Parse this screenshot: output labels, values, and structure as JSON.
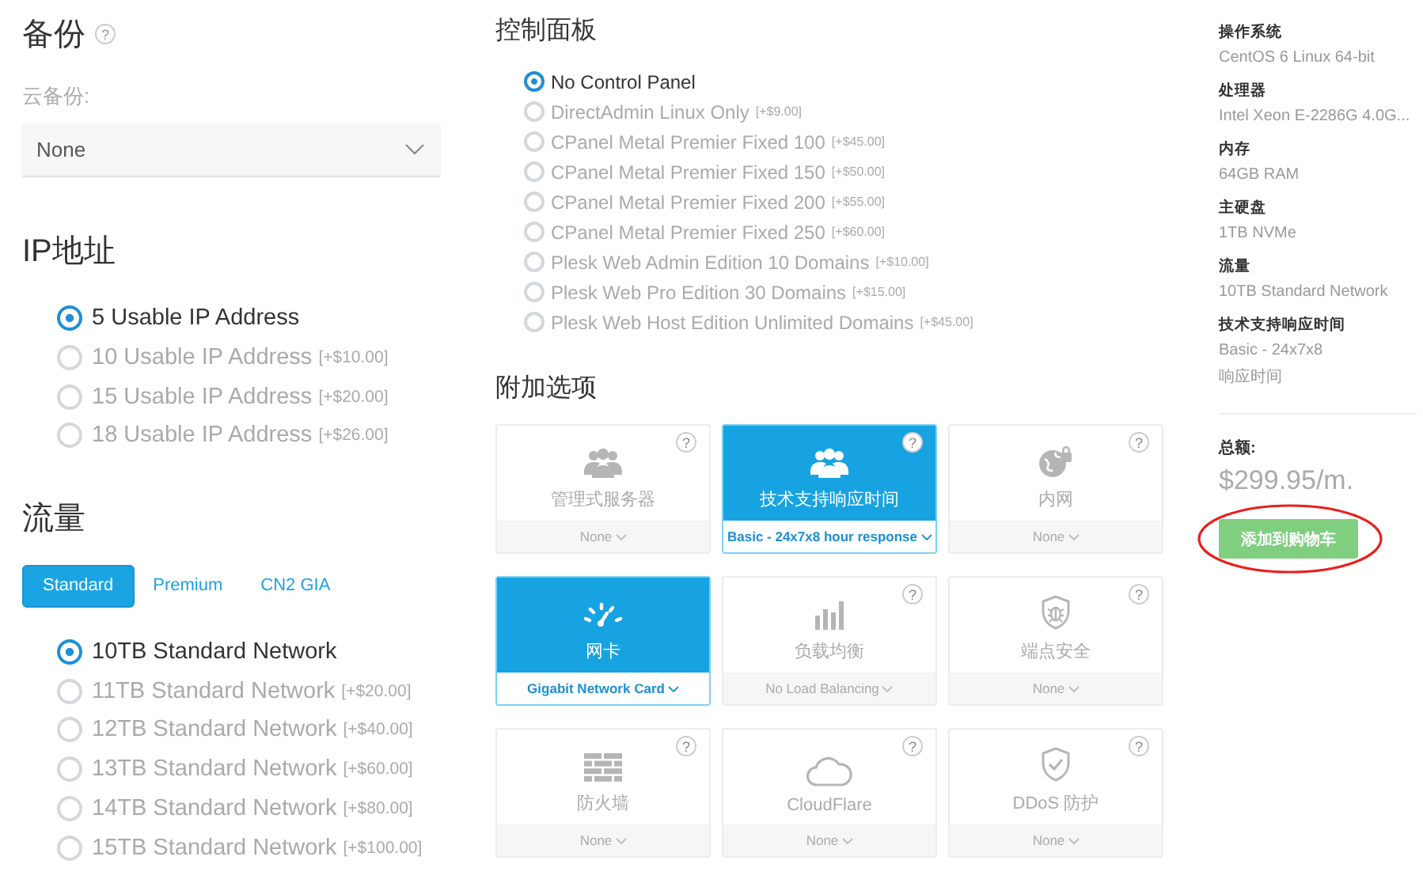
{
  "backup": {
    "title": "备份",
    "help": "?",
    "field_label": "云备份:",
    "select": {
      "value": "None"
    }
  },
  "ip": {
    "title": "IP地址",
    "options": [
      {
        "label": "5 Usable IP Address",
        "selected": true
      },
      {
        "label": "10 Usable IP Address",
        "price": "[+$10.00]",
        "selected": false
      },
      {
        "label": "15 Usable IP Address",
        "price": "[+$20.00]",
        "selected": false
      },
      {
        "label": "18 Usable IP Address",
        "price": "[+$26.00]",
        "selected": false
      }
    ]
  },
  "traffic": {
    "title": "流量",
    "tabs": [
      {
        "label": "Standard",
        "selected": true
      },
      {
        "label": "Premium",
        "selected": false
      },
      {
        "label": "CN2 GIA",
        "selected": false
      }
    ],
    "options": [
      {
        "label": "10TB Standard Network",
        "selected": true
      },
      {
        "label": "11TB Standard Network",
        "price": "[+$20.00]",
        "selected": false
      },
      {
        "label": "12TB Standard Network",
        "price": "[+$40.00]",
        "selected": false
      },
      {
        "label": "13TB Standard Network",
        "price": "[+$60.00]",
        "selected": false
      },
      {
        "label": "14TB Standard Network",
        "price": "[+$80.00]",
        "selected": false
      },
      {
        "label": "15TB Standard Network",
        "price": "[+$100.00]",
        "selected": false
      }
    ]
  },
  "control_panel": {
    "title": "控制面板",
    "options": [
      {
        "label": "No Control Panel",
        "selected": true
      },
      {
        "label": "DirectAdmin Linux Only",
        "price": "[+$9.00]",
        "selected": false
      },
      {
        "label": "CPanel Metal Premier Fixed 100",
        "price": "[+$45.00]",
        "selected": false
      },
      {
        "label": "CPanel Metal Premier Fixed 150",
        "price": "[+$50.00]",
        "selected": false
      },
      {
        "label": "CPanel Metal Premier Fixed 200",
        "price": "[+$55.00]",
        "selected": false
      },
      {
        "label": "CPanel Metal Premier Fixed 250",
        "price": "[+$60.00]",
        "selected": false
      },
      {
        "label": "Plesk Web Admin Edition 10 Domains",
        "price": "[+$10.00]",
        "selected": false
      },
      {
        "label": "Plesk Web Pro Edition 30 Domains",
        "price": "[+$15.00]",
        "selected": false
      },
      {
        "label": "Plesk Web Host Edition Unlimited Domains",
        "price": "[+$45.00]",
        "selected": false
      }
    ]
  },
  "addons": {
    "title": "附加选项",
    "cards": [
      {
        "name": "管理式服务器",
        "value": "None",
        "help": "?",
        "selected": false
      },
      {
        "name": "技术支持响应时间",
        "value": "Basic - 24x7x8 hour response",
        "help": "?",
        "selected": true
      },
      {
        "name": "内网",
        "value": "None",
        "help": "?",
        "selected": false
      },
      {
        "name": "网卡",
        "value": "Gigabit Network Card",
        "selected": true
      },
      {
        "name": "负载均衡",
        "value": "No Load Balancing",
        "help": "?",
        "selected": false
      },
      {
        "name": "端点安全",
        "value": "None",
        "help": "?",
        "selected": false
      },
      {
        "name": "防火墙",
        "value": "None",
        "help": "?",
        "selected": false
      },
      {
        "name": "CloudFlare",
        "value": "None",
        "help": "?",
        "selected": false
      },
      {
        "name": "DDoS 防护",
        "value": "None",
        "help": "?",
        "selected": false
      }
    ]
  },
  "summary": {
    "items": [
      {
        "label": "操作系统",
        "value_lines": [
          "CentOS 6 Linux 64-bit"
        ]
      },
      {
        "label": "处理器",
        "value_lines": [
          "Intel Xeon E-2286G 4.0G..."
        ]
      },
      {
        "label": "内存",
        "value_lines": [
          "64GB RAM"
        ]
      },
      {
        "label": "主硬盘",
        "value_lines": [
          "1TB NVMe"
        ]
      },
      {
        "label": "流量",
        "value_lines": [
          "10TB Standard Network"
        ]
      },
      {
        "label": "技术支持响应时间",
        "value_lines": [
          "Basic - 24x7x8",
          "响应时间"
        ]
      }
    ],
    "total_label": "总额:",
    "total": "$299.95/m.",
    "button": {
      "label": "添加到购物车",
      "highlighted": true
    }
  }
}
